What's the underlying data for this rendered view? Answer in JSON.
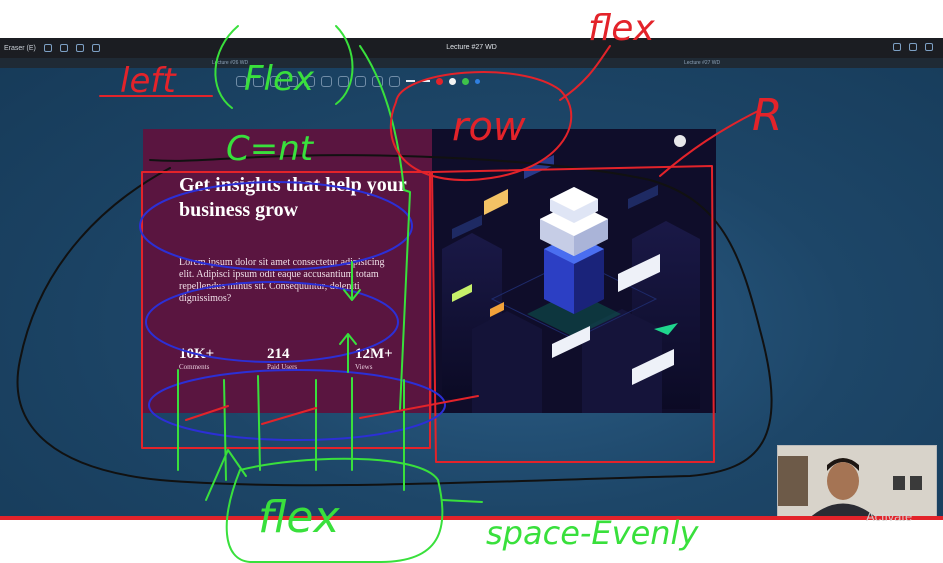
{
  "window": {
    "title": "Lecture #27 WD",
    "left_label": "Eraser (E)",
    "sub_left": "Lecture #26 WD",
    "sub_right": "Lecture #27 WD"
  },
  "slide": {
    "headline": "Get insights that help your business grow",
    "body": "Lorem ipsum dolor sit amet consectetur adipisicing elit. Adipisci ipsum odit eaque accusantium totam repellendus minus sit. Consequuntur, deleniti dignissimos?",
    "stats": [
      {
        "value": "10K+",
        "label": "Comments"
      },
      {
        "value": "214",
        "label": "Paid Users"
      },
      {
        "value": "12M+",
        "label": "Views"
      }
    ]
  },
  "annotations": {
    "left": "left",
    "flex_top": "Flex",
    "cent": "C=nt",
    "flex_red": "flex",
    "row": "row",
    "r": "R",
    "flex_bottom": "flex",
    "space_evenly": "space-Evenly"
  },
  "overlay": {
    "activate": "Activate"
  },
  "colors": {
    "left_panel": "#5a1540",
    "right_panel": "#0f0d2a",
    "annotation_red": "#e3232a",
    "annotation_green": "#39e03c",
    "annotation_blue": "#2c2fd6",
    "annotation_black": "#111111"
  }
}
